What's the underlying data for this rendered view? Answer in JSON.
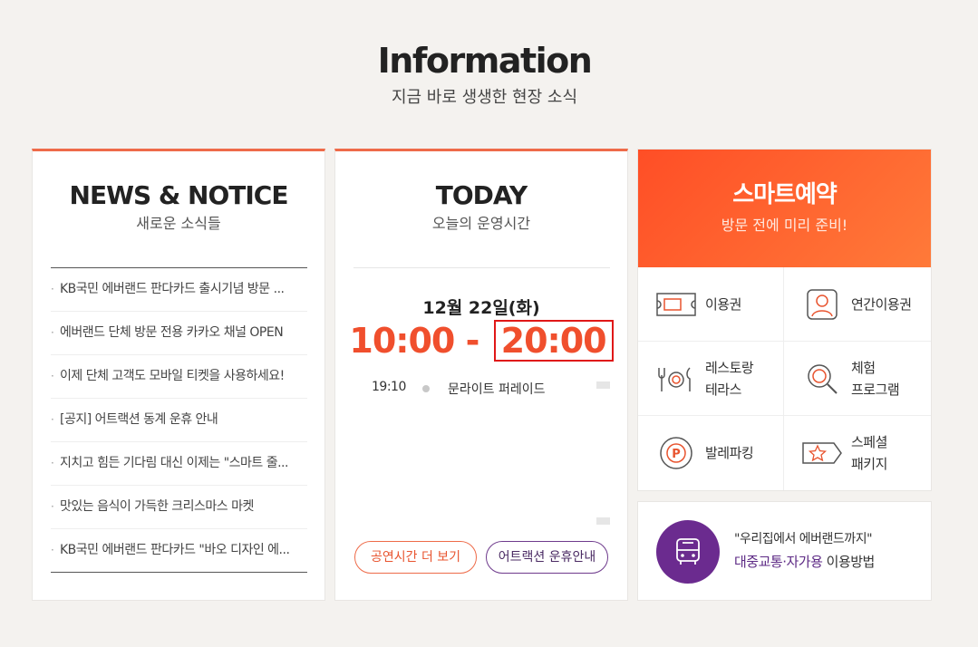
{
  "header": {
    "title": "Information",
    "subtitle": "지금 바로 생생한 현장 소식"
  },
  "news": {
    "title": "NEWS & NOTICE",
    "subtitle": "새로운 소식들",
    "bullet": "·",
    "items": [
      "KB국민 에버랜드 판다카드 출시기념 방문 ...",
      "에버랜드 단체 방문 전용 카카오 채널 OPEN",
      "이제 단체 고객도 모바일 티켓을 사용하세요!",
      "[공지] 어트랙션 동계 운휴 안내",
      "지치고 힘든 기다림 대신 이제는 \"스마트 줄...",
      "맛있는 음식이 가득한 크리스마스 마켓",
      "KB국민 에버랜드 판다카드 \"바오 디자인 에..."
    ]
  },
  "today": {
    "title": "TODAY",
    "subtitle": "오늘의 운영시간",
    "date": "12월 22일(화)",
    "open": "10:00",
    "dash": "-",
    "close": "20:00",
    "schedule": [
      {
        "time": "19:10",
        "name": "문라이트 퍼레이드"
      }
    ],
    "btn_show": "공연시간 더 보기",
    "btn_attraction": "어트랙션 운휴안내"
  },
  "smart": {
    "title": "스마트예약",
    "subtitle": "방문 전에 미리 준비!",
    "items": [
      {
        "line1": "이용권",
        "line2": "",
        "icon": "ticket-icon"
      },
      {
        "line1": "연간이용권",
        "line2": "",
        "icon": "annual-pass-icon"
      },
      {
        "line1": "레스토랑",
        "line2": "테라스",
        "icon": "restaurant-icon"
      },
      {
        "line1": "체험",
        "line2": "프로그램",
        "icon": "magnifier-icon"
      },
      {
        "line1": "발레파킹",
        "line2": "",
        "icon": "parking-icon"
      },
      {
        "line1": "스페셜",
        "line2": "패키지",
        "icon": "star-tag-icon"
      }
    ]
  },
  "transport": {
    "line1": "\"우리집에서 에버랜드까지\"",
    "line2_strong": "대중교통·자가용",
    "line2_rest": " 이용방법",
    "icon": "bus-icon"
  },
  "colors": {
    "accent": "#ee6b49",
    "hours": "#f04f2d",
    "highlight_box": "#e01818",
    "purple": "#6b2b8f",
    "smart_gradient_start": "#ff4e26",
    "smart_gradient_end": "#ff7a39"
  }
}
